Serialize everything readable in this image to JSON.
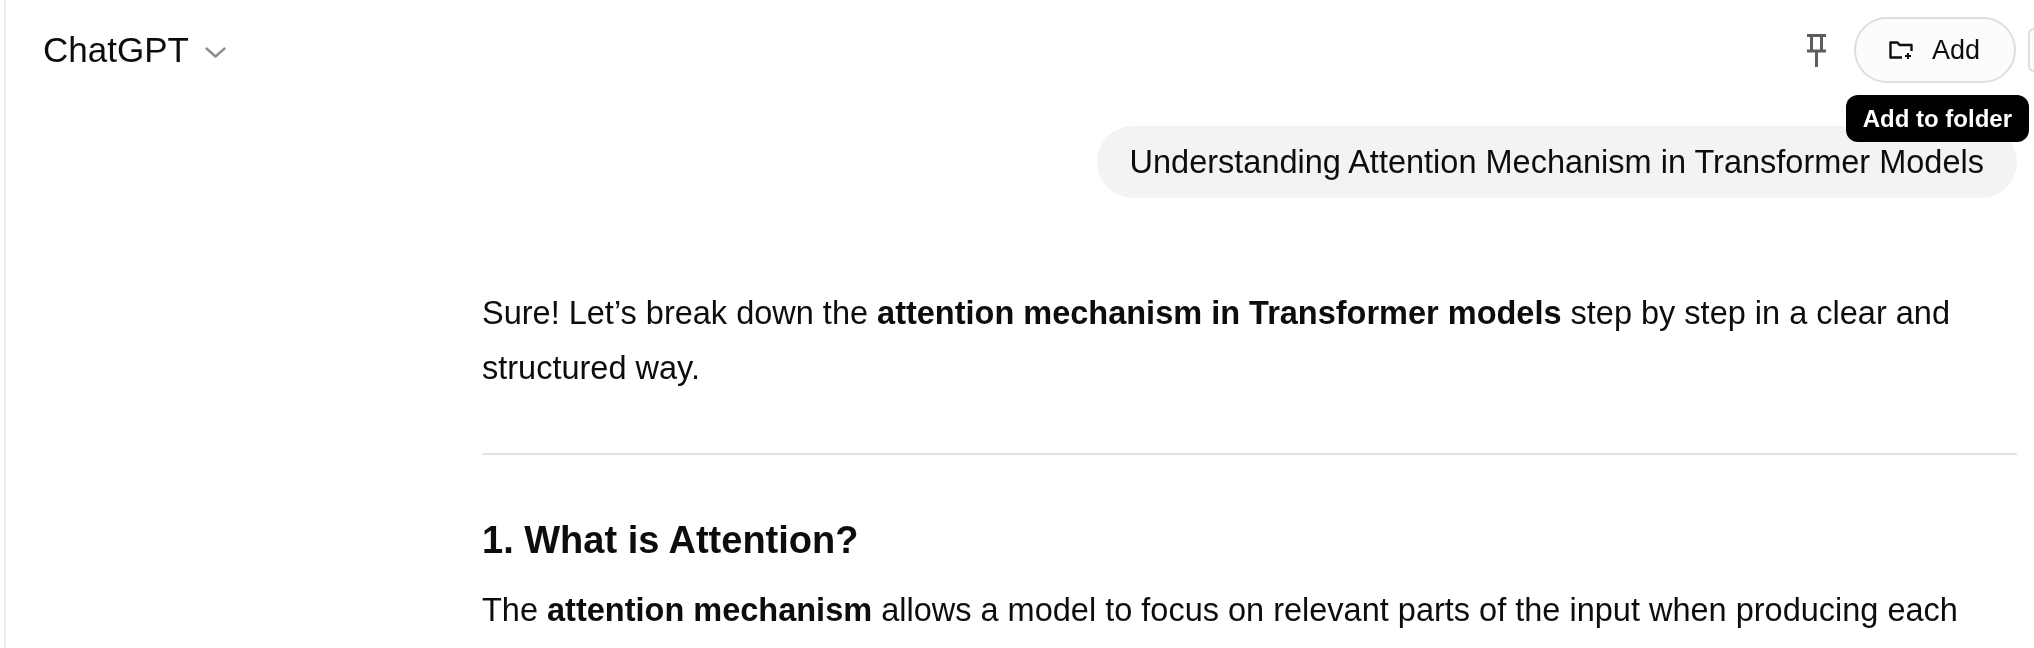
{
  "header": {
    "model_selector": {
      "label": "ChatGPT"
    },
    "add_button": {
      "label": "Add"
    },
    "tooltip": {
      "text": "Add to folder"
    }
  },
  "user_message": {
    "text": "Understanding Attention Mechanism in Transformer Models"
  },
  "response": [
    {
      "kind": "paragraph",
      "text": "Sure! Let’s break down the **attention mechanism in Transformer models** step by step in a clear and structured way."
    },
    {
      "kind": "divider"
    },
    {
      "kind": "heading",
      "text": "1. What is Attention?"
    },
    {
      "kind": "paragraph",
      "text": "The **attention mechanism** allows a model to focus on relevant parts of the input when producing each"
    }
  ]
}
